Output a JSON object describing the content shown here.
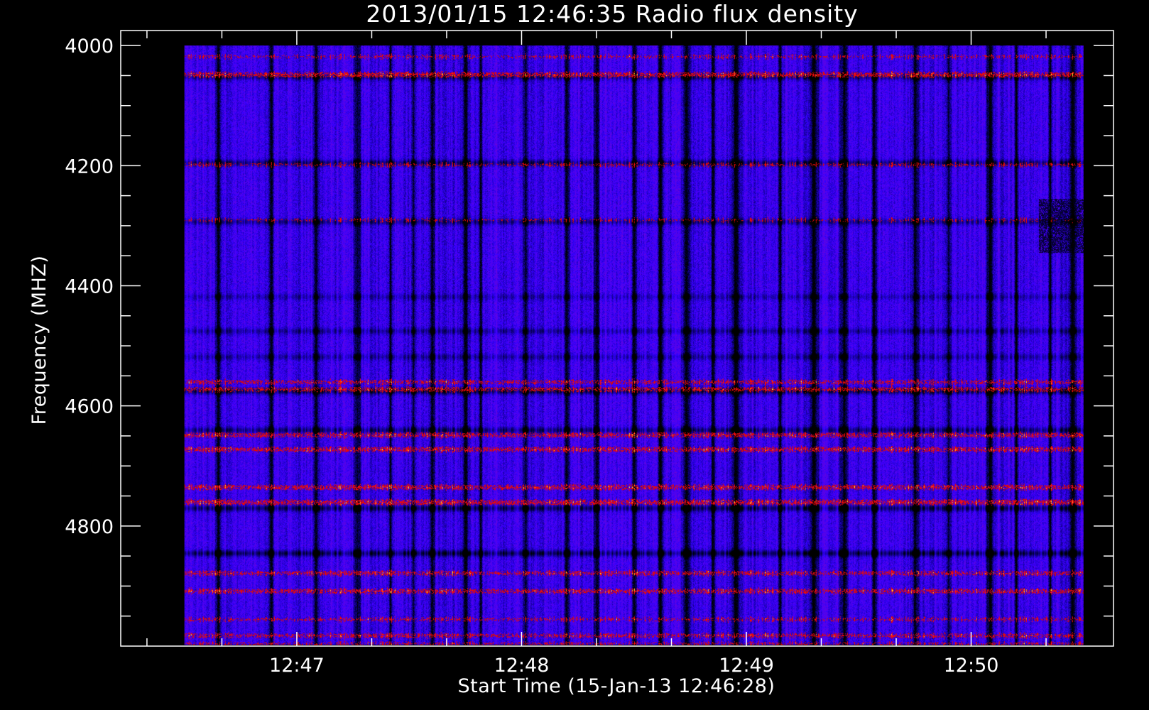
{
  "chart_data": {
    "type": "heatmap",
    "title": "2013/01/15 12:46:35 Radio flux density",
    "xlabel": "Start Time (15-Jan-13 12:46:28)",
    "ylabel": "Frequency (MHZ)",
    "x_tick_labels": [
      "12:47",
      "12:48",
      "12:49",
      "12:50"
    ],
    "x_major_ticks_seconds": [
      32,
      92,
      152,
      212
    ],
    "x_minor_tick_step_seconds": 20,
    "xlim_seconds": [
      -15,
      250
    ],
    "data_x_range_seconds": [
      2,
      242
    ],
    "y_tick_labels": [
      "4000",
      "4200",
      "4400",
      "4600",
      "4800"
    ],
    "y_major_ticks_mhz": [
      4000,
      4200,
      4400,
      4600,
      4800
    ],
    "y_minor_tick_step_mhz": 50,
    "ylim_mhz": [
      3975,
      5000
    ],
    "data_y_range_mhz": [
      4000,
      4998
    ],
    "y_reversed": true,
    "colormap": [
      "#000000",
      "#0000ff",
      "#7a1fb0",
      "#ff0000",
      "#ffff00"
    ],
    "colors": {
      "background": "#000000",
      "base": "#4a10ee",
      "foreground": "#ffffff"
    },
    "horizontal_bands": [
      {
        "mhz": 4018,
        "kind": "red",
        "strength": 0.55
      },
      {
        "mhz": 4048,
        "kind": "red",
        "strength": 0.9
      },
      {
        "mhz": 4052,
        "kind": "black",
        "strength": 0.6
      },
      {
        "mhz": 4195,
        "kind": "black",
        "strength": 0.65
      },
      {
        "mhz": 4198,
        "kind": "red",
        "strength": 0.55
      },
      {
        "mhz": 4290,
        "kind": "red",
        "strength": 0.5
      },
      {
        "mhz": 4293,
        "kind": "black",
        "strength": 0.55
      },
      {
        "mhz": 4418,
        "kind": "black",
        "strength": 0.35
      },
      {
        "mhz": 4475,
        "kind": "black",
        "strength": 0.45
      },
      {
        "mhz": 4518,
        "kind": "black",
        "strength": 0.4
      },
      {
        "mhz": 4560,
        "kind": "red",
        "strength": 0.7
      },
      {
        "mhz": 4572,
        "kind": "red",
        "strength": 0.75
      },
      {
        "mhz": 4575,
        "kind": "black",
        "strength": 0.8
      },
      {
        "mhz": 4640,
        "kind": "black",
        "strength": 0.6
      },
      {
        "mhz": 4648,
        "kind": "red",
        "strength": 0.8
      },
      {
        "mhz": 4672,
        "kind": "red",
        "strength": 0.85
      },
      {
        "mhz": 4735,
        "kind": "red",
        "strength": 0.85
      },
      {
        "mhz": 4760,
        "kind": "red",
        "strength": 0.95
      },
      {
        "mhz": 4770,
        "kind": "black",
        "strength": 0.7
      },
      {
        "mhz": 4845,
        "kind": "black",
        "strength": 0.75
      },
      {
        "mhz": 4878,
        "kind": "red",
        "strength": 0.75
      },
      {
        "mhz": 4908,
        "kind": "red",
        "strength": 0.8
      },
      {
        "mhz": 4955,
        "kind": "red",
        "strength": 0.6
      },
      {
        "mhz": 4982,
        "kind": "red",
        "strength": 0.7
      },
      {
        "mhz": 4996,
        "kind": "red",
        "strength": 0.6
      }
    ],
    "vertical_dark_stripes_seconds": [
      11,
      25,
      37,
      48,
      57,
      63,
      68,
      77,
      81,
      93,
      104,
      112,
      122,
      129,
      136,
      143,
      149,
      161,
      170,
      178,
      186,
      197,
      206,
      217,
      224,
      233,
      239
    ],
    "dark_patch": {
      "x_seconds": [
        230,
        242
      ],
      "mhz": [
        4255,
        4345
      ]
    },
    "grid": false,
    "legend": "none"
  }
}
